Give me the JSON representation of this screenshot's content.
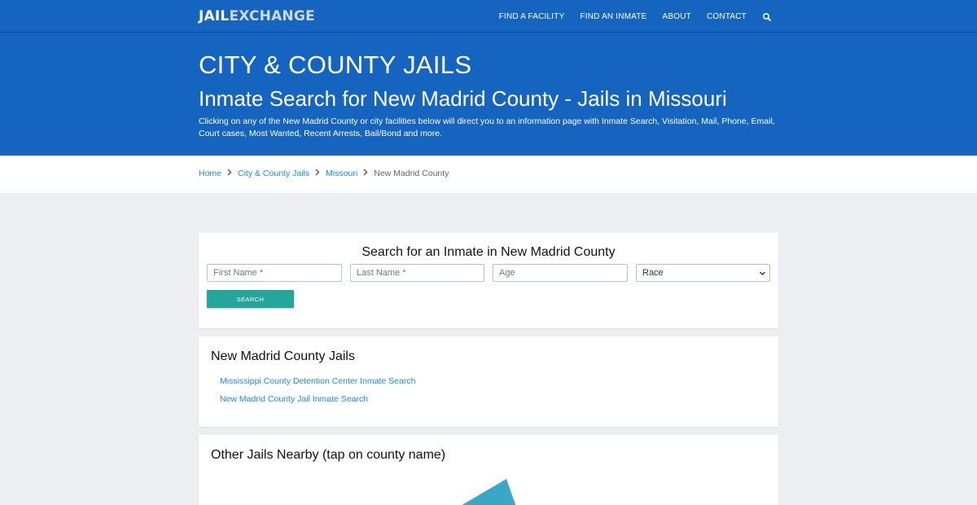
{
  "header": {
    "logo_part1": "JAIL",
    "logo_part2": "EXCHANGE",
    "nav": [
      "FIND A FACILITY",
      "FIND AN INMATE",
      "ABOUT",
      "CONTACT"
    ]
  },
  "hero": {
    "title": "CITY & COUNTY JAILS",
    "subtitle": "Inmate Search for New Madrid County - Jails in Missouri",
    "description": "Clicking on any of the New Madrid County or city facilities below will direct you to an information page with Inmate Search, Visitation, Mail, Phone, Email, Court cases, Most Wanted, Recent Arrests, Bail/Bond and more."
  },
  "breadcrumb": {
    "items": [
      "Home",
      "City & County Jails",
      "Missouri"
    ],
    "current": "New Madrid County"
  },
  "search_form": {
    "title": "Search for an Inmate in New Madrid County",
    "first_name_placeholder": "First Name *",
    "last_name_placeholder": "Last Name *",
    "age_placeholder": "Age",
    "race_selected": "Race",
    "button_label": "SEARCH"
  },
  "jails_section": {
    "title": "New Madrid County Jails",
    "links": [
      "Mississippi County Detention Center Inmate Search",
      "New Madrid County Jail Inmate Search"
    ]
  },
  "nearby_section": {
    "title": "Other Jails Nearby (tap on county name)"
  },
  "colors": {
    "brand_blue": "#1565c0",
    "link_blue": "#1e88e5",
    "button_teal": "#26a69a",
    "map_teal": "#3aa7c6"
  },
  "icons": {
    "nav_search": "search-icon",
    "breadcrumb_separator": "chevron-right-icon",
    "select_arrow": "chevron-down-icon"
  }
}
